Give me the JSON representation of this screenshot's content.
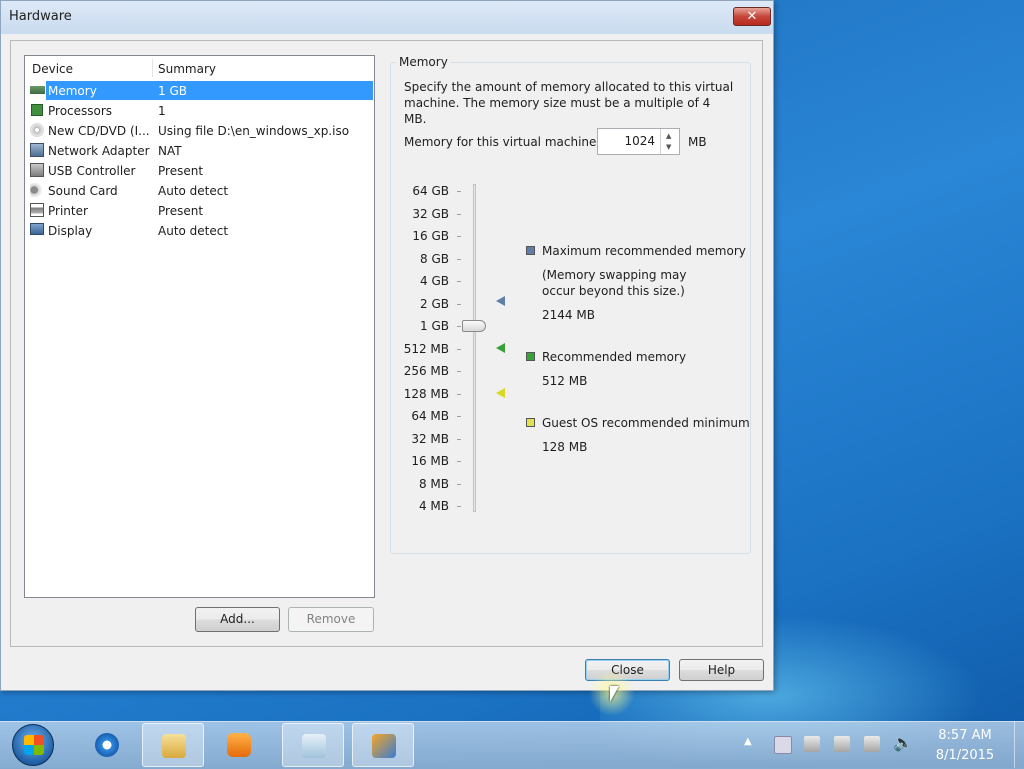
{
  "dialog": {
    "title": "Hardware",
    "close_glyph": "✕",
    "columns": {
      "device": "Device",
      "summary": "Summary"
    },
    "devices": [
      {
        "name": "Memory",
        "summary": "1 GB",
        "icon": "memory-icon",
        "selected": true
      },
      {
        "name": "Processors",
        "summary": "1",
        "icon": "processor-icon"
      },
      {
        "name": "New CD/DVD (I...",
        "summary": "Using file D:\\en_windows_xp.iso",
        "icon": "cd-dvd-icon"
      },
      {
        "name": "Network Adapter",
        "summary": "NAT",
        "icon": "network-adapter-icon"
      },
      {
        "name": "USB Controller",
        "summary": "Present",
        "icon": "usb-icon"
      },
      {
        "name": "Sound Card",
        "summary": "Auto detect",
        "icon": "sound-card-icon"
      },
      {
        "name": "Printer",
        "summary": "Present",
        "icon": "printer-icon"
      },
      {
        "name": "Display",
        "summary": "Auto detect",
        "icon": "display-icon"
      }
    ],
    "add_label": "Add...",
    "remove_label": "Remove",
    "close_label": "Close",
    "help_label": "Help"
  },
  "memory": {
    "group_title": "Memory",
    "description": "Specify the amount of memory allocated to this virtual machine. The memory size must be a multiple of 4 MB.",
    "field_label": "Memory for this virtual machine:",
    "value": "1024",
    "unit": "MB",
    "scale": [
      "64 GB",
      "32 GB",
      "16 GB",
      "8 GB",
      "4 GB",
      "2 GB",
      "1 GB",
      "512 MB",
      "256 MB",
      "128 MB",
      "64 MB",
      "32 MB",
      "16 MB",
      "8 MB",
      "4 MB"
    ],
    "max_title": "Maximum recommended memory",
    "max_note_1": "(Memory swapping may",
    "max_note_2": "occur beyond this size.)",
    "max_value": "2144 MB",
    "rec_title": "Recommended memory",
    "rec_value": "512 MB",
    "min_title": "Guest OS recommended minimum",
    "min_value": "128 MB",
    "colors": {
      "max": "#5f7fa6",
      "rec": "#3aa13a",
      "min": "#e0e050"
    }
  },
  "taskbar": {
    "apps": [
      "internet-explorer-icon",
      "file-explorer-icon",
      "media-player-icon",
      "notepad-icon",
      "vmware-icon"
    ],
    "time": "8:57 AM",
    "date": "8/1/2015"
  }
}
